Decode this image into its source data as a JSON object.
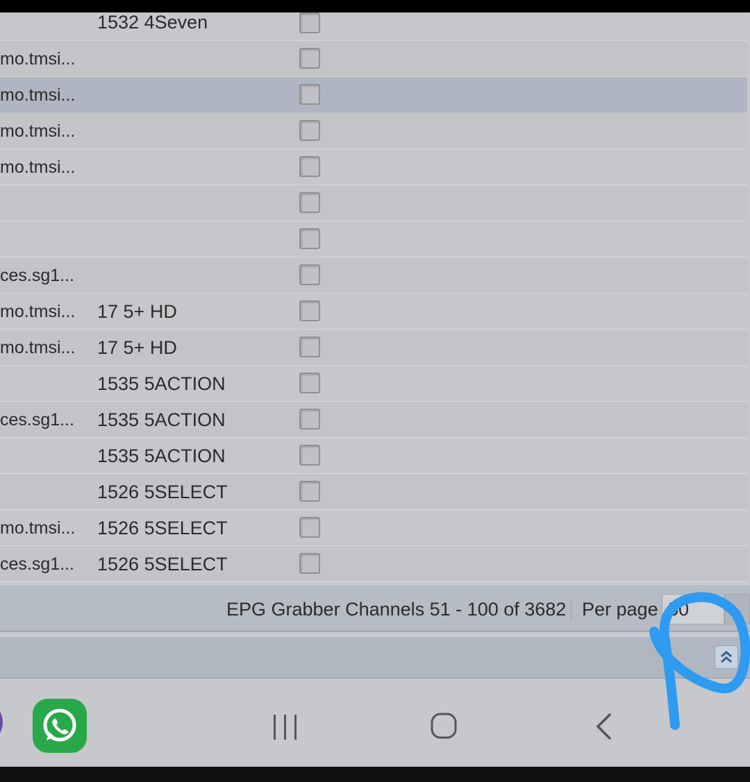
{
  "table": {
    "rows": [
      {
        "col_a": "",
        "col_b": "1532 4Seven",
        "selected": false
      },
      {
        "col_a": "mo.tmsi...",
        "col_b": "",
        "selected": false
      },
      {
        "col_a": "mo.tmsi...",
        "col_b": "",
        "selected": true
      },
      {
        "col_a": "mo.tmsi...",
        "col_b": "",
        "selected": false
      },
      {
        "col_a": "mo.tmsi...",
        "col_b": "",
        "selected": false
      },
      {
        "col_a": "",
        "col_b": "",
        "selected": false
      },
      {
        "col_a": "",
        "col_b": "",
        "selected": false
      },
      {
        "col_a": "ces.sg1...",
        "col_b": "",
        "selected": false
      },
      {
        "col_a": "mo.tmsi...",
        "col_b": "17 5+ HD",
        "selected": false
      },
      {
        "col_a": "mo.tmsi...",
        "col_b": "17 5+ HD",
        "selected": false
      },
      {
        "col_a": "",
        "col_b": "1535 5ACTION",
        "selected": false
      },
      {
        "col_a": "ces.sg1...",
        "col_b": "1535 5ACTION",
        "selected": false
      },
      {
        "col_a": "",
        "col_b": "1535 5ACTION",
        "selected": false
      },
      {
        "col_a": "",
        "col_b": "1526 5SELECT",
        "selected": false
      },
      {
        "col_a": "mo.tmsi...",
        "col_b": "1526 5SELECT",
        "selected": false
      },
      {
        "col_a": "ces.sg1...",
        "col_b": "1526 5SELECT",
        "selected": false
      }
    ]
  },
  "pager": {
    "summary": "EPG Grabber Channels 51 - 100 of 3682",
    "per_page_label": "Per page",
    "per_page_value": "50"
  },
  "collapse_icon": "double-chevron-up-icon",
  "navbar": {
    "apps": [
      "purple-app-icon",
      "whatsapp-icon"
    ],
    "buttons": [
      "recent-apps-icon",
      "home-icon",
      "back-icon"
    ]
  },
  "colors": {
    "selected_row": "#afb6c2",
    "annotation_stroke": "#2e9bf0",
    "whatsapp_green": "#29a84a"
  }
}
